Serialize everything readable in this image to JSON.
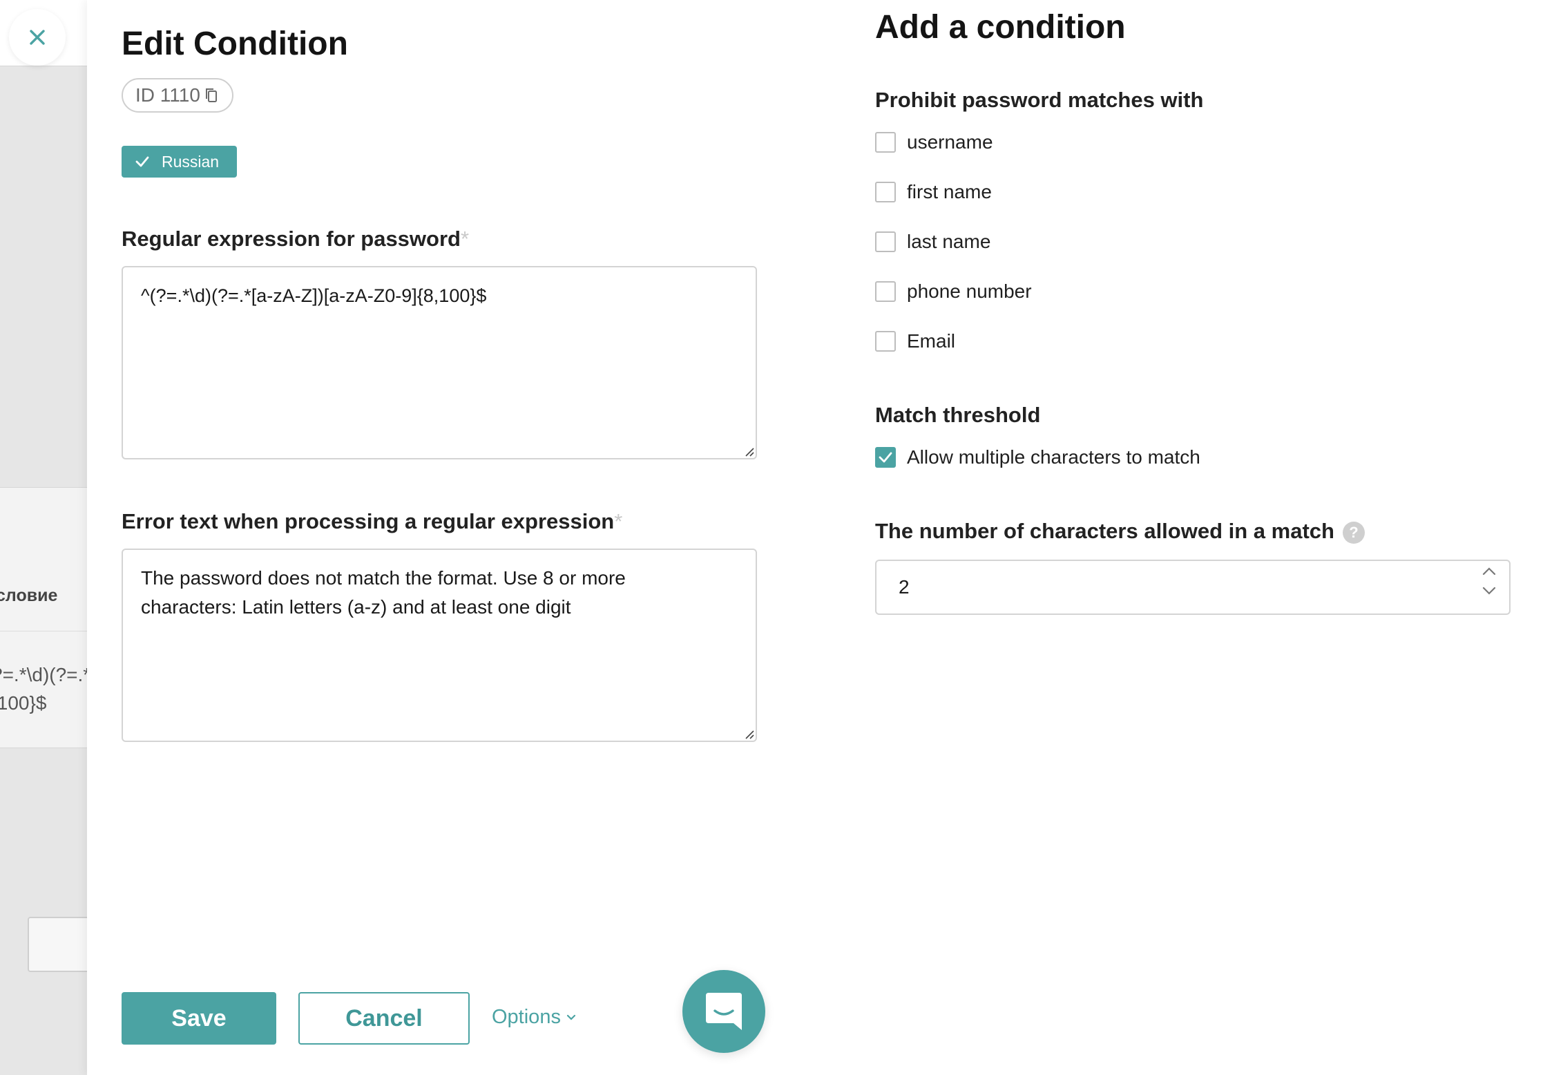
{
  "background": {
    "card_title_fragment": "словие",
    "card_regex_fragment": "?=.*\\d)(?=.*\n,100}$"
  },
  "left_panel": {
    "title": "Edit Condition",
    "id_chip": "ID 1110",
    "language_badge": "Russian",
    "regex_field": {
      "label": "Regular expression for password",
      "required_mark": "*",
      "value": "^(?=.*\\d)(?=.*[a-zA-Z])[a-zA-Z0-9]{8,100}$"
    },
    "error_field": {
      "label": "Error text when processing a regular expression",
      "required_mark": "*",
      "value": "The password does not match the format. Use 8 or more characters: Latin letters (a-z) and at least one digit"
    },
    "buttons": {
      "save": "Save",
      "cancel": "Cancel",
      "options": "Options"
    }
  },
  "right_panel": {
    "title": "Add a condition",
    "prohibit_section": {
      "heading": "Prohibit password matches with",
      "options": [
        {
          "label": "username",
          "checked": false
        },
        {
          "label": "first name",
          "checked": false
        },
        {
          "label": "last name",
          "checked": false
        },
        {
          "label": "phone number",
          "checked": false
        },
        {
          "label": "Email",
          "checked": false
        }
      ]
    },
    "threshold_section": {
      "heading": "Match threshold",
      "allow_multiple": {
        "label": "Allow multiple characters to match",
        "checked": true
      }
    },
    "characters_section": {
      "heading": "The number of characters allowed in a match",
      "help_icon": "?",
      "value": "2"
    }
  },
  "colors": {
    "accent": "#4ba3a3",
    "border": "#d4d4d4",
    "background_page": "#e6e6e6"
  },
  "icons": {
    "close": "close-icon",
    "copy": "copy-icon",
    "check": "checkmark-icon",
    "chevron_down": "chevron-down-icon",
    "chat": "chat-icon",
    "help": "help-icon"
  }
}
